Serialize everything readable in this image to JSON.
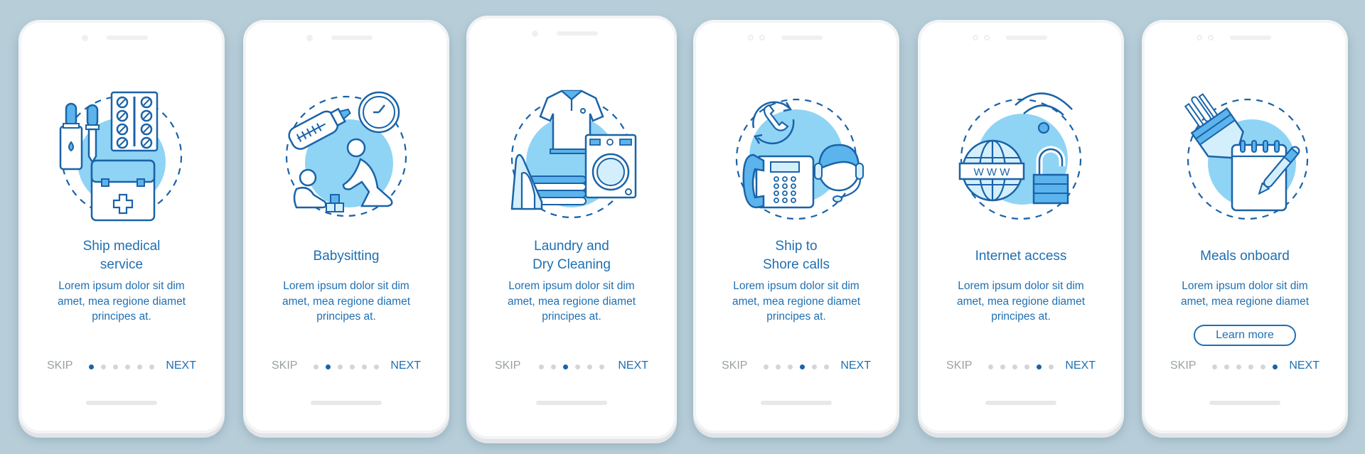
{
  "screens": [
    {
      "illustration": "ship-medical-service-icon",
      "title_lines": [
        "Ship medical",
        "service"
      ],
      "body_lines": [
        "Lorem ipsum dolor sit dim",
        "amet, mea regione diamet",
        "principes at."
      ],
      "skip_label": "SKIP",
      "next_label": "NEXT",
      "page_index": 1,
      "page_count": 6
    },
    {
      "illustration": "babysitting-icon",
      "title_lines": [
        "Babysitting"
      ],
      "body_lines": [
        "Lorem ipsum dolor sit dim",
        "amet, mea regione diamet",
        "principes at."
      ],
      "skip_label": "SKIP",
      "next_label": "NEXT",
      "page_index": 2,
      "page_count": 6
    },
    {
      "illustration": "laundry-icon",
      "title_lines": [
        "Laundry and",
        "Dry Cleaning"
      ],
      "body_lines": [
        "Lorem ipsum dolor sit dim",
        "amet, mea regione diamet",
        "principes at."
      ],
      "skip_label": "SKIP",
      "next_label": "NEXT",
      "page_index": 3,
      "page_count": 6
    },
    {
      "illustration": "ship-to-shore-calls-icon",
      "title_lines": [
        "Ship to",
        "Shore calls"
      ],
      "body_lines": [
        "Lorem ipsum dolor sit dim",
        "amet, mea regione diamet",
        "principes at."
      ],
      "skip_label": "SKIP",
      "next_label": "NEXT",
      "page_index": 4,
      "page_count": 6
    },
    {
      "illustration": "internet-access-icon",
      "title_lines": [
        "Internet access"
      ],
      "body_lines": [
        "Lorem ipsum dolor sit dim",
        "amet, mea regione diamet",
        "principes at."
      ],
      "skip_label": "SKIP",
      "next_label": "NEXT",
      "page_index": 5,
      "page_count": 6
    },
    {
      "illustration": "meals-onboard-icon",
      "title_lines": [
        "Meals onboard"
      ],
      "body_lines": [
        "Lorem ipsum dolor sit dim",
        "amet, mea regione diamet"
      ],
      "button_label": "Learn more",
      "skip_label": "SKIP",
      "next_label": "NEXT",
      "page_index": 6,
      "page_count": 6
    }
  ],
  "colors": {
    "background": "#b7ced9",
    "accent_blue": "#1f6fb2",
    "stroke_blue": "#1a63a8",
    "fill_light_blue": "#8fd4f5",
    "fill_mid_blue": "#5cb4ec",
    "fill_pale_blue": "#d4effc",
    "inactive_dot": "#d3d6d8",
    "skip_gray": "#9aa0a4"
  }
}
